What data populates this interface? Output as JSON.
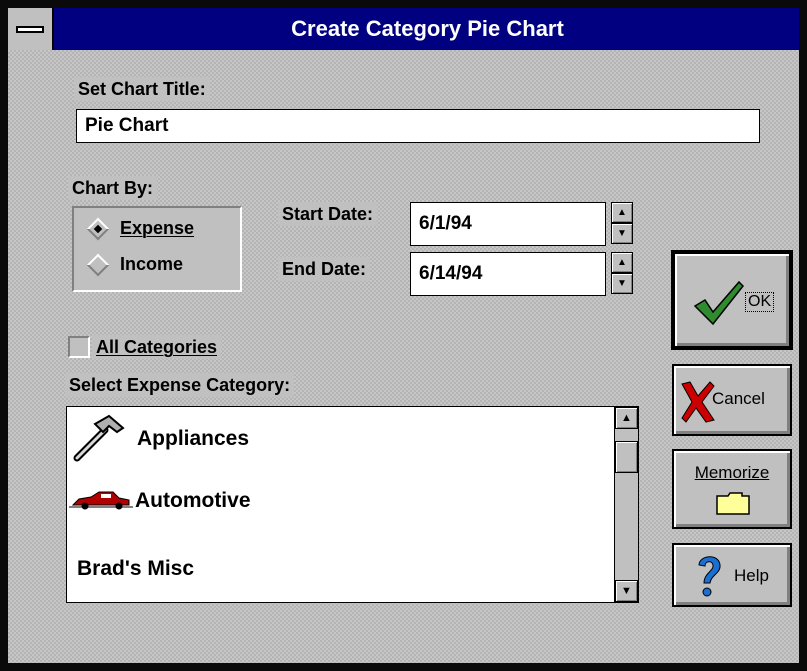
{
  "window": {
    "title": "Create Category Pie Chart"
  },
  "chart_title": {
    "label": "Set Chart Title:",
    "value": "Pie Chart"
  },
  "chart_by": {
    "label": "Chart By:",
    "options": [
      {
        "label": "Expense",
        "selected": true
      },
      {
        "label": "Income",
        "selected": false
      }
    ]
  },
  "dates": {
    "start_label": "Start Date:",
    "start_value": "6/1/94",
    "end_label": "End Date:",
    "end_value": "6/14/94"
  },
  "all_categories": {
    "label": "All Categories",
    "checked": false
  },
  "category_list": {
    "label": "Select Expense Category:",
    "items": [
      {
        "label": "Appliances",
        "icon": "hammer-icon"
      },
      {
        "label": "Automotive",
        "icon": "car-icon"
      },
      {
        "label": "Brad's Misc",
        "icon": ""
      }
    ]
  },
  "buttons": {
    "ok": "OK",
    "cancel": "Cancel",
    "memorize": "Memorize",
    "help": "Help"
  },
  "colors": {
    "titlebar": "#000080",
    "face": "#c0c0c0",
    "ok_check": "#2e8b2e",
    "cancel_x": "#cc0000",
    "help_q": "#1a6fd1",
    "folder": "#ffff99"
  }
}
